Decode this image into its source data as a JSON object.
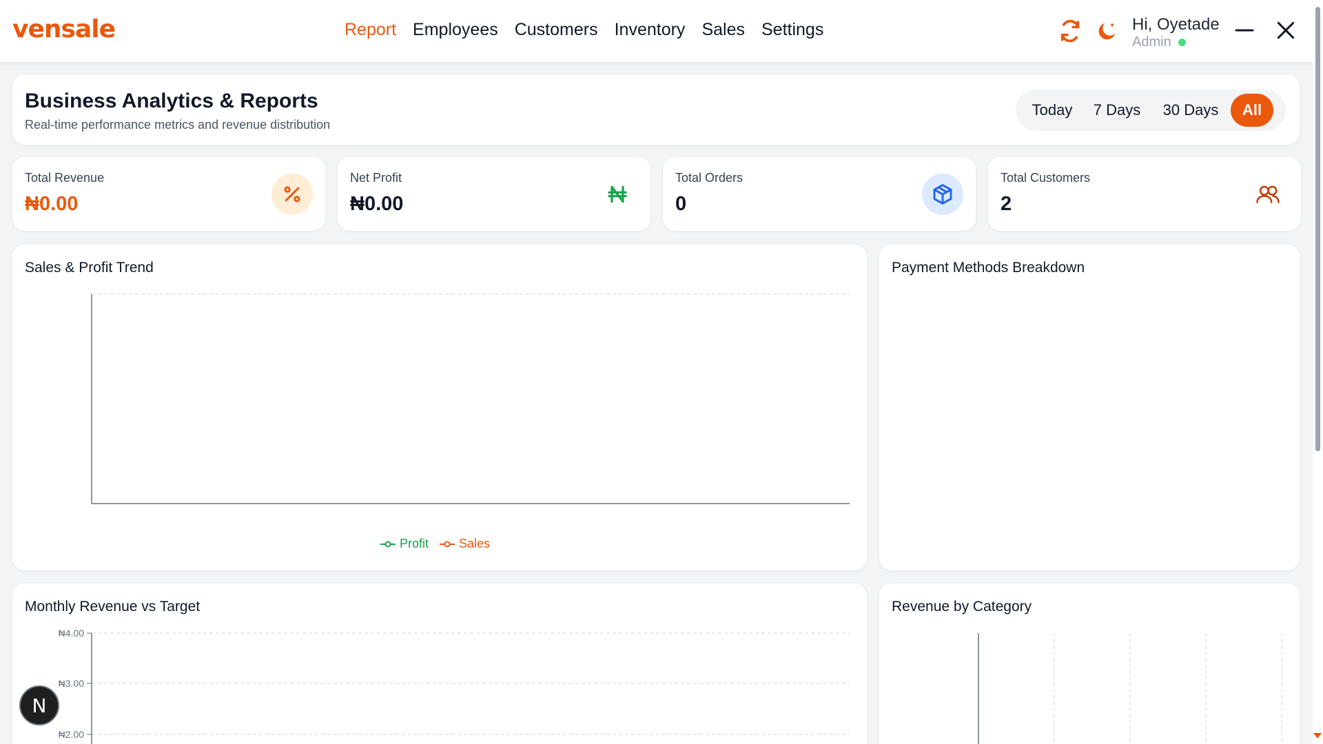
{
  "app": {
    "logo": "vensale"
  },
  "nav": {
    "items": [
      {
        "label": "Report"
      },
      {
        "label": "Employees"
      },
      {
        "label": "Customers"
      },
      {
        "label": "Inventory"
      },
      {
        "label": "Sales"
      },
      {
        "label": "Settings"
      }
    ],
    "active": "Report"
  },
  "user": {
    "greeting": "Hi, Oyetade",
    "role": "Admin",
    "status_color": "#4ade80"
  },
  "icons": {
    "refresh": "refresh-icon",
    "theme": "moon-icon",
    "minimize": "minimize-icon",
    "close": "close-icon"
  },
  "colors": {
    "accent": "#ea580c",
    "green": "#16a34a",
    "blue": "#2563eb"
  },
  "header": {
    "title": "Business Analytics & Reports",
    "subtitle": "Real-time performance metrics and revenue distribution",
    "ranges": [
      "Today",
      "7 Days",
      "30 Days",
      "All"
    ],
    "active_range": "All"
  },
  "stats": [
    {
      "label": "Total Revenue",
      "value": "₦0.00",
      "icon": "percent-icon"
    },
    {
      "label": "Net Profit",
      "value": "₦0.00",
      "icon": "naira-icon"
    },
    {
      "label": "Total Orders",
      "value": "0",
      "icon": "box-icon"
    },
    {
      "label": "Total Customers",
      "value": "2",
      "icon": "users-icon"
    }
  ],
  "charts": {
    "sales_trend": {
      "title": "Sales & Profit Trend"
    },
    "payment_methods": {
      "title": "Payment Methods Breakdown"
    },
    "monthly_revenue": {
      "title": "Monthly Revenue vs Target"
    },
    "category_revenue": {
      "title": "Revenue by Category"
    }
  },
  "chart_data": [
    {
      "type": "line",
      "title": "Sales & Profit Trend",
      "x": [],
      "series": [
        {
          "name": "Profit",
          "values": [],
          "color": "#16a34a"
        },
        {
          "name": "Sales",
          "values": [],
          "color": "#ea580c"
        }
      ],
      "grid": true,
      "legend": "bottom"
    },
    {
      "type": "pie",
      "title": "Payment Methods Breakdown",
      "categories": [],
      "values": []
    },
    {
      "type": "bar",
      "title": "Monthly Revenue vs Target",
      "categories": [],
      "yticks": [
        "₦4.00",
        "₦3.00",
        "₦2.00"
      ],
      "ylim": [
        2,
        4
      ],
      "grid": true
    },
    {
      "type": "bar",
      "title": "Revenue by Category",
      "categories": [],
      "values": [],
      "grid": true
    }
  ],
  "fab": {
    "label": "N"
  }
}
